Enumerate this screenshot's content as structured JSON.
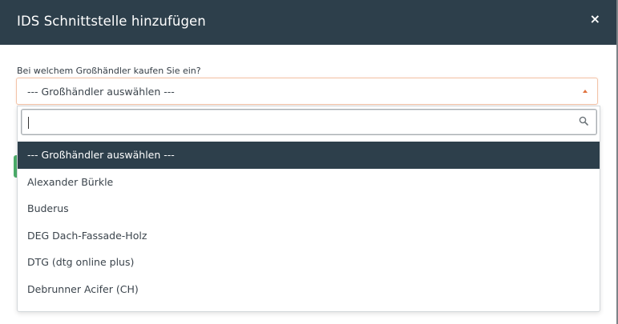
{
  "modal": {
    "title": "IDS Schnittstelle hinzufügen",
    "close_label": "×"
  },
  "form": {
    "label": "Bei welchem Großhändler kaufen Sie ein?",
    "selected_value": "--- Großhändler auswählen ---"
  },
  "dropdown": {
    "search_value": "",
    "search_icon": "magnifier-icon",
    "options": [
      {
        "label": "--- Großhändler auswählen ---",
        "selected": true
      },
      {
        "label": "Alexander Bürkle",
        "selected": false
      },
      {
        "label": "Buderus",
        "selected": false
      },
      {
        "label": "DEG Dach-Fassade-Holz",
        "selected": false
      },
      {
        "label": "DTG (dtg online plus)",
        "selected": false
      },
      {
        "label": "Debrunner Acifer (CH)",
        "selected": false
      }
    ]
  },
  "colors": {
    "header_bg": "#2d3f4b",
    "accent": "#e0733e",
    "success": "#4cae6a"
  }
}
